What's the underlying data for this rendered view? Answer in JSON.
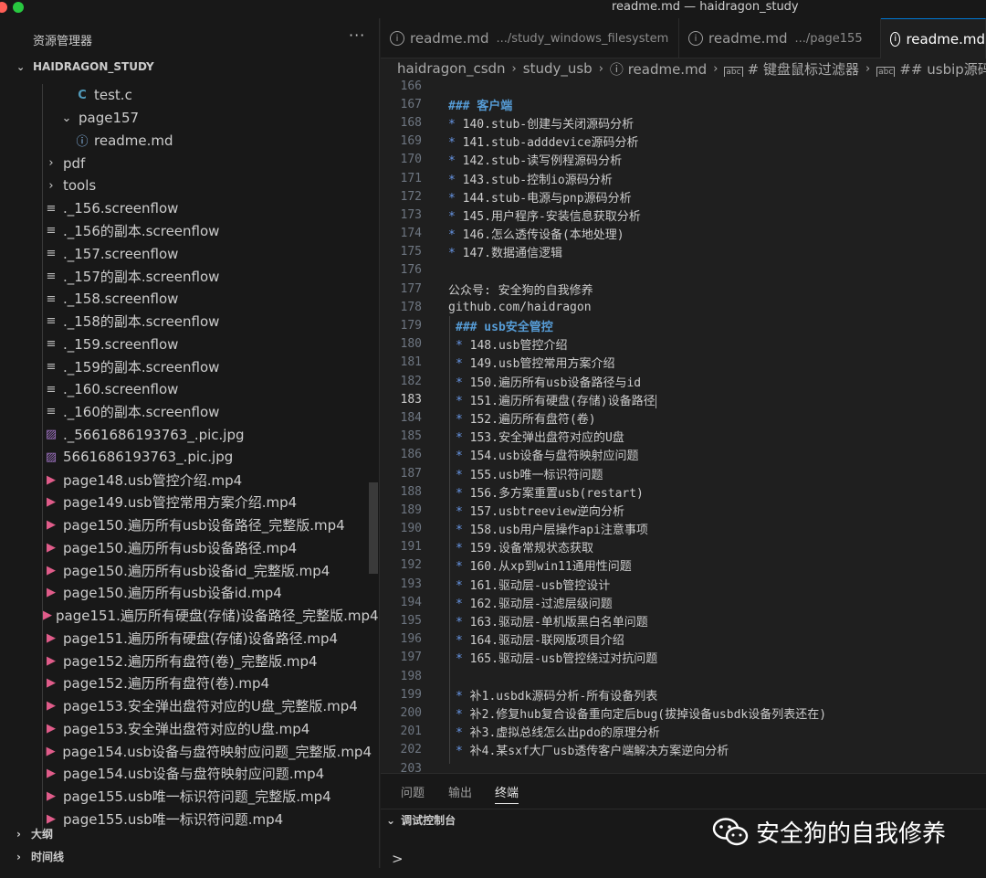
{
  "window": {
    "title": "readme.md — haidragon_study",
    "colors": {
      "close": "#ff5f57",
      "zoom": "#28c840",
      "accent": "#0078d4"
    }
  },
  "sidebar": {
    "header": "资源管理器",
    "more": "···",
    "workspace": "HAIDRAGON_STUDY",
    "items": [
      {
        "icon": "c-file-icon",
        "glyph": "C",
        "label": "test.c",
        "indent": 3
      },
      {
        "icon": "chevron-down-icon",
        "glyph": "⌄",
        "label": "page157",
        "indent": 2
      },
      {
        "icon": "info-icon",
        "glyph": "ⓘ",
        "label": "readme.md",
        "indent": 3
      },
      {
        "icon": "chevron-right-icon",
        "glyph": "›",
        "label": "pdf",
        "indent": 1
      },
      {
        "icon": "chevron-right-icon",
        "glyph": "›",
        "label": "tools",
        "indent": 1
      },
      {
        "icon": "lines-icon",
        "glyph": "≡",
        "label": "._156.screenflow",
        "indent": 1
      },
      {
        "icon": "lines-icon",
        "glyph": "≡",
        "label": "._156的副本.screenflow",
        "indent": 1
      },
      {
        "icon": "lines-icon",
        "glyph": "≡",
        "label": "._157.screenflow",
        "indent": 1
      },
      {
        "icon": "lines-icon",
        "glyph": "≡",
        "label": "._157的副本.screenflow",
        "indent": 1
      },
      {
        "icon": "lines-icon",
        "glyph": "≡",
        "label": "._158.screenflow",
        "indent": 1
      },
      {
        "icon": "lines-icon",
        "glyph": "≡",
        "label": "._158的副本.screenflow",
        "indent": 1
      },
      {
        "icon": "lines-icon",
        "glyph": "≡",
        "label": "._159.screenflow",
        "indent": 1
      },
      {
        "icon": "lines-icon",
        "glyph": "≡",
        "label": "._159的副本.screenflow",
        "indent": 1
      },
      {
        "icon": "lines-icon",
        "glyph": "≡",
        "label": "._160.screenflow",
        "indent": 1
      },
      {
        "icon": "lines-icon",
        "glyph": "≡",
        "label": "._160的副本.screenflow",
        "indent": 1
      },
      {
        "icon": "image-icon",
        "glyph": "▨",
        "label": "._5661686193763_.pic.jpg",
        "indent": 1
      },
      {
        "icon": "image-icon",
        "glyph": "▨",
        "label": "5661686193763_.pic.jpg",
        "indent": 1
      },
      {
        "icon": "video-icon",
        "glyph": "▶",
        "label": "page148.usb管控介绍.mp4",
        "indent": 1
      },
      {
        "icon": "video-icon",
        "glyph": "▶",
        "label": "page149.usb管控常用方案介绍.mp4",
        "indent": 1
      },
      {
        "icon": "video-icon",
        "glyph": "▶",
        "label": "page150.遍历所有usb设备路径_完整版.mp4",
        "indent": 1
      },
      {
        "icon": "video-icon",
        "glyph": "▶",
        "label": "page150.遍历所有usb设备路径.mp4",
        "indent": 1
      },
      {
        "icon": "video-icon",
        "glyph": "▶",
        "label": "page150.遍历所有usb设备id_完整版.mp4",
        "indent": 1
      },
      {
        "icon": "video-icon",
        "glyph": "▶",
        "label": "page150.遍历所有usb设备id.mp4",
        "indent": 1
      },
      {
        "icon": "video-icon",
        "glyph": "▶",
        "label": "page151.遍历所有硬盘(存储)设备路径_完整版.mp4",
        "indent": 1
      },
      {
        "icon": "video-icon",
        "glyph": "▶",
        "label": "page151.遍历所有硬盘(存储)设备路径.mp4",
        "indent": 1
      },
      {
        "icon": "video-icon",
        "glyph": "▶",
        "label": "page152.遍历所有盘符(卷)_完整版.mp4",
        "indent": 1
      },
      {
        "icon": "video-icon",
        "glyph": "▶",
        "label": "page152.遍历所有盘符(卷).mp4",
        "indent": 1
      },
      {
        "icon": "video-icon",
        "glyph": "▶",
        "label": "page153.安全弹出盘符对应的U盘_完整版.mp4",
        "indent": 1
      },
      {
        "icon": "video-icon",
        "glyph": "▶",
        "label": "page153.安全弹出盘符对应的U盘.mp4",
        "indent": 1
      },
      {
        "icon": "video-icon",
        "glyph": "▶",
        "label": "page154.usb设备与盘符映射应问题_完整版.mp4",
        "indent": 1
      },
      {
        "icon": "video-icon",
        "glyph": "▶",
        "label": "page154.usb设备与盘符映射应问题.mp4",
        "indent": 1
      },
      {
        "icon": "video-icon",
        "glyph": "▶",
        "label": "page155.usb唯一标识符问题_完整版.mp4",
        "indent": 1
      },
      {
        "icon": "video-icon",
        "glyph": "▶",
        "label": "page155.usb唯一标识符问题.mp4",
        "indent": 1
      }
    ],
    "outline": "大纲",
    "timeline": "时间线"
  },
  "tabs": [
    {
      "label": "readme.md",
      "path": ".../study_windows_filesystem",
      "active": false
    },
    {
      "label": "readme.md",
      "path": ".../page155",
      "active": false
    },
    {
      "label": "readme.md",
      "path": "",
      "active": true
    }
  ],
  "breadcrumb": {
    "p1": "haidragon_csdn",
    "p2": "study_usb",
    "p3": "readme.md",
    "p4": "# 键盘鼠标过滤器",
    "p5": "## usbip源码分析(w"
  },
  "editor": {
    "current_line": 183,
    "lines": [
      {
        "n": "166",
        "text": "",
        "kind": "plain"
      },
      {
        "n": "167",
        "text": "### 客户端",
        "kind": "heading"
      },
      {
        "n": "168",
        "text": "140.stub-创建与关闭源码分析",
        "kind": "bullet"
      },
      {
        "n": "169",
        "text": "141.stub-adddevice源码分析",
        "kind": "bullet"
      },
      {
        "n": "170",
        "text": "142.stub-读写例程源码分析",
        "kind": "bullet"
      },
      {
        "n": "171",
        "text": "143.stub-控制io源码分析",
        "kind": "bullet"
      },
      {
        "n": "172",
        "text": "144.stub-电源与pnp源码分析",
        "kind": "bullet"
      },
      {
        "n": "173",
        "text": "145.用户程序-安装信息获取分析",
        "kind": "bullet"
      },
      {
        "n": "174",
        "text": "146.怎么透传设备(本地处理)",
        "kind": "bullet"
      },
      {
        "n": "175",
        "text": "147.数据通信逻辑",
        "kind": "bullet"
      },
      {
        "n": "176",
        "text": "",
        "kind": "plain"
      },
      {
        "n": "177",
        "text": "公众号: 安全狗的自我修养",
        "kind": "plain"
      },
      {
        "n": "178",
        "text": "github.com/haidragon",
        "kind": "plain"
      },
      {
        "n": "179",
        "text": "### usb安全管控",
        "kind": "heading-ind"
      },
      {
        "n": "180",
        "text": "148.usb管控介绍",
        "kind": "bullet-ind"
      },
      {
        "n": "181",
        "text": "149.usb管控常用方案介绍",
        "kind": "bullet-ind"
      },
      {
        "n": "182",
        "text": "150.遍历所有usb设备路径与id",
        "kind": "bullet-ind"
      },
      {
        "n": "183",
        "text": "151.遍历所有硬盘(存储)设备路径",
        "kind": "bullet-ind"
      },
      {
        "n": "184",
        "text": "152.遍历所有盘符(卷)",
        "kind": "bullet-ind"
      },
      {
        "n": "185",
        "text": "153.安全弹出盘符对应的U盘",
        "kind": "bullet-ind"
      },
      {
        "n": "186",
        "text": "154.usb设备与盘符映射应问题",
        "kind": "bullet-ind"
      },
      {
        "n": "187",
        "text": "155.usb唯一标识符问题",
        "kind": "bullet-ind"
      },
      {
        "n": "188",
        "text": "156.多方案重置usb(restart)",
        "kind": "bullet-ind"
      },
      {
        "n": "189",
        "text": "157.usbtreeview逆向分析",
        "kind": "bullet-ind"
      },
      {
        "n": "190",
        "text": "158.usb用户层操作api注意事项",
        "kind": "bullet-ind"
      },
      {
        "n": "191",
        "text": "159.设备常规状态获取",
        "kind": "bullet-ind"
      },
      {
        "n": "192",
        "text": "160.从xp到win11通用性问题",
        "kind": "bullet-ind"
      },
      {
        "n": "193",
        "text": "161.驱动层-usb管控设计",
        "kind": "bullet-ind"
      },
      {
        "n": "194",
        "text": "162.驱动层-过滤层级问题",
        "kind": "bullet-ind"
      },
      {
        "n": "195",
        "text": "163.驱动层-单机版黑白名单问题",
        "kind": "bullet-ind"
      },
      {
        "n": "196",
        "text": "164.驱动层-联网版项目介绍",
        "kind": "bullet-ind"
      },
      {
        "n": "197",
        "text": "165.驱动层-usb管控绕过对抗问题",
        "kind": "bullet-ind"
      },
      {
        "n": "198",
        "text": "",
        "kind": "plain"
      },
      {
        "n": "199",
        "text": "补1.usbdk源码分析-所有设备列表",
        "kind": "bullet-ind"
      },
      {
        "n": "200",
        "text": "补2.修复hub复合设备重向定后bug(拔掉设备usbdk设备列表还在)",
        "kind": "bullet-ind"
      },
      {
        "n": "201",
        "text": "补3.虚拟总线怎么出pdo的原理分析",
        "kind": "bullet-ind"
      },
      {
        "n": "202",
        "text": "补4.某sxf大厂usb透传客户端解决方案逆向分析",
        "kind": "bullet-ind"
      },
      {
        "n": "203",
        "text": "",
        "kind": "plain"
      }
    ]
  },
  "panel": {
    "tabs": [
      "问题",
      "输出",
      "终端"
    ],
    "active_tab": "终端",
    "debug_console": "调试控制台",
    "prompt": ">"
  },
  "watermark": "安全狗的自我修养"
}
